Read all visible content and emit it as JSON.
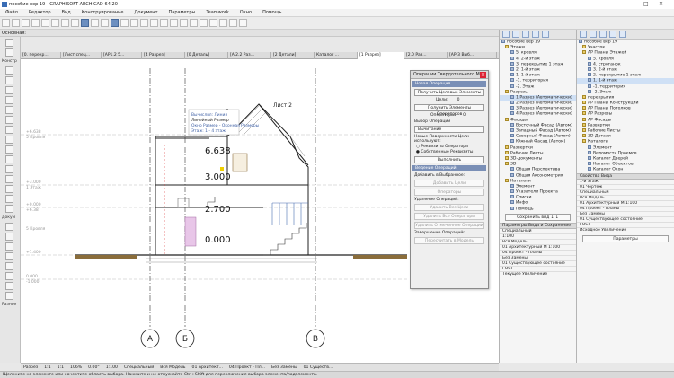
{
  "window": {
    "title": "пособие вер 19 - GRAPHISOFT ARCHICAD-64 20",
    "controls": [
      "–",
      "□",
      "✕"
    ]
  },
  "menu": [
    "Файл",
    "Редактор",
    "Вид",
    "Конструирование",
    "Документ",
    "Параметры",
    "Teamwork",
    "Окно",
    "Помощь"
  ],
  "infobar": {
    "label": "Основная:"
  },
  "toolbox": {
    "groups": [
      "Констр",
      "Докум",
      "Разное"
    ]
  },
  "tabs": [
    "[0. перекр...",
    "[Лист спец...",
    "[АР1.2 5...",
    "[4 Разрез]",
    "[0 Деталь]",
    "[A.2.2 Раз...",
    "[2 Детали]",
    "Каталог ...",
    "[1 Разрез]",
    "[2.0 Раз...",
    "[АР-3 Выб..."
  ],
  "drawing": {
    "sheet_label": "Лист 2",
    "levels": [
      "6.638",
      "3.000",
      "2.700",
      "0.000"
    ],
    "axes": [
      "А",
      "Б",
      "В"
    ],
    "tooltip": [
      "Вычислял: Линия",
      "Линейный Размер",
      "Окно Размер - Оконная Размеры",
      "Этаж: 1 - 4 этаж"
    ],
    "left_marks": [
      "+6.638",
      "5 Кровля",
      "+3.000",
      "1 Этаж",
      "+0.000",
      "+6.38",
      "5 Кровля",
      "+1.400",
      "0.000",
      "-1.000"
    ]
  },
  "operations": {
    "title": "Операции Твердотельного М...",
    "close_label": "×",
    "new_section": "Новая Операция",
    "get_targets": "Получить Целевые Элементы",
    "targets_label": "Цели:",
    "targets_value": "0",
    "get_operators": "Получить Элементы Операторов",
    "operators_label": "Операторы:",
    "operators_value": "0",
    "choose_label": "Выбор Операции",
    "operation_value": "Вычитание",
    "new_surfaces_label": "Новые Поверхности Цели используют:",
    "radio1": "Реквизиты Оператора",
    "radio2": "Собственные Реквизиты",
    "execute": "Выполнить",
    "link_section": "Ведение Операций",
    "add_to_selected": "Добавить в Выбранное:",
    "add_targets": "Добавить Цели",
    "add_operators": "Операторы",
    "delete_label": "Удаление Операций:",
    "delete_all": "Удалить Все Цели",
    "delete_operators": "Удалить Все Операторы",
    "delete_selected": "Удалить Отмеченное Операции",
    "finish_label": "Завершение Операций:",
    "reset_button": "Пересчитать в Модель"
  },
  "navigator": {
    "root": "пособие вер 19",
    "items": [
      {
        "t": "Этажи",
        "f": true
      },
      {
        "t": "5. кровля"
      },
      {
        "t": "4. 2-й этаж"
      },
      {
        "t": "3. перекрытие 1 этаж"
      },
      {
        "t": "2. 1-й этаж"
      },
      {
        "t": "1. 1-й этаж"
      },
      {
        "t": "-1. территория"
      },
      {
        "t": "-2. Этаж"
      },
      {
        "t": "Разрезы",
        "f": true
      },
      {
        "t": "1 Разрез (Автоматически)",
        "s": true
      },
      {
        "t": "2 Разрез (Автоматически)"
      },
      {
        "t": "3 Разрез (Автоматически)"
      },
      {
        "t": "4 Разрез (Автоматически)"
      },
      {
        "t": "Фасады",
        "f": true
      },
      {
        "t": "Восточный Фасад (Автом)"
      },
      {
        "t": "Западный Фасад (Автом)"
      },
      {
        "t": "Северный Фасад (Автом)"
      },
      {
        "t": "Южный Фасад (Автом)"
      },
      {
        "t": "Развертки",
        "f": true
      },
      {
        "t": "Рабочие Листы",
        "f": true
      },
      {
        "t": "3D-документы",
        "f": true
      },
      {
        "t": "3D",
        "f": true
      },
      {
        "t": "Общая Перспектива"
      },
      {
        "t": "Общая Аксонометрия"
      },
      {
        "t": "Каталоги",
        "f": true
      },
      {
        "t": "Элемент"
      },
      {
        "t": "Указатели Проекта"
      },
      {
        "t": "Списки"
      },
      {
        "t": "Инфо"
      },
      {
        "t": "Помощь"
      }
    ],
    "save_button": "Сохранить вид ↓ ↓",
    "props_header": "Параметры Вида и Сохранение",
    "props": [
      "Специальный",
      "1:100",
      "Вся Модель",
      "01 Архитектурный М 1:100",
      "04 Проект - Планы",
      "Без Замены",
      "01 Существующее состояние",
      "ГОСТ",
      "Текущее Увеличение"
    ]
  },
  "viewmap": {
    "root": "пособие вер 19",
    "items": [
      {
        "t": "Участок",
        "f": true
      },
      {
        "t": "АР Планы Этажей",
        "f": true
      },
      {
        "t": "5. кровля"
      },
      {
        "t": "4. строганок"
      },
      {
        "t": "3. 2-й этаж"
      },
      {
        "t": "2. перекрытие 1 этаж"
      },
      {
        "t": "1. 1-й этаж",
        "s": true
      },
      {
        "t": "-1. территория"
      },
      {
        "t": "-2. Этаж"
      },
      {
        "t": "перекрытия",
        "f": true
      },
      {
        "t": "АР Планы Конструкции",
        "f": true
      },
      {
        "t": "АР Планы Потолков",
        "f": true
      },
      {
        "t": "АР Разрезы",
        "f": true
      },
      {
        "t": "АР Фасады",
        "f": true
      },
      {
        "t": "Развертки",
        "f": true
      },
      {
        "t": "Рабочие Листы",
        "f": true
      },
      {
        "t": "3D Детали",
        "f": true
      },
      {
        "t": "Каталоги",
        "f": true
      },
      {
        "t": "Элемент"
      },
      {
        "t": "Ведомость Проемов"
      },
      {
        "t": "Каталог Дверей"
      },
      {
        "t": "Каталог Объектов"
      },
      {
        "t": "Каталог Окон"
      }
    ],
    "props_header": "Свойства Вида",
    "props": [
      "1-й этаж",
      "01 Чертеж",
      "Специальный",
      "Вся Модель",
      "01 Архитектурный М 1:100",
      "04 Проект - Планы",
      "Без Замены",
      "01 Существующее состояние",
      "ГОСТ",
      "Исходное Увеличение"
    ],
    "bottom_button": "Параметры"
  },
  "bottombar": [
    "Разрез",
    "1:1",
    "1:1",
    "106%",
    "0.00°",
    "1:100",
    "Специальный",
    "Вся Модель",
    "01 Архитект...",
    "04 Проект - Пл...",
    "Без Замены",
    "01 Существ..."
  ],
  "status": "Щелкните на элементе или начертите область выбора. Нажмите и не отпускайте Ctrl+Shift для переключения выбора элемента/подэлемента.",
  "colors": {
    "accent": "#7a8fb6",
    "selection": "#cfe0f5"
  }
}
